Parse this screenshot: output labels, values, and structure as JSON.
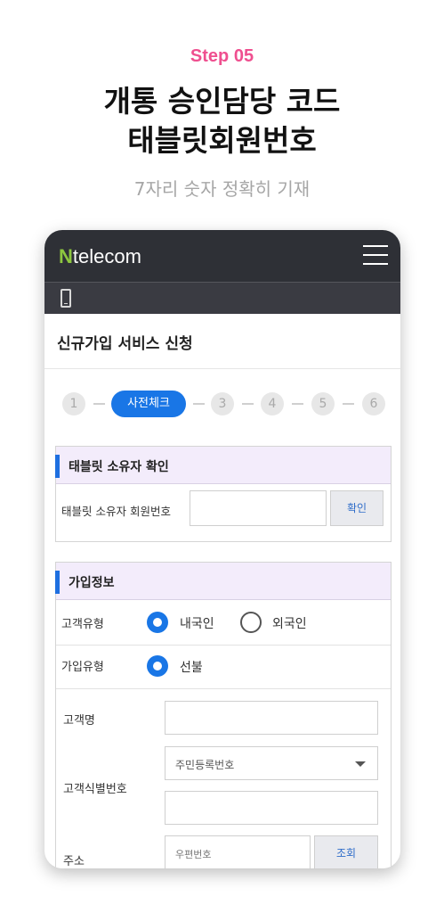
{
  "intro": {
    "step": "Step 05",
    "title_line1": "개통 승인담당 코드",
    "title_line2": "태블릿회원번호",
    "subtitle": "7자리 숫자 정확히 기재"
  },
  "app": {
    "logo_n": "N",
    "logo_rest": "telecom",
    "page_title": "신규가입 서비스 신청"
  },
  "stepper": {
    "steps": [
      "1",
      "사전체크",
      "3",
      "4",
      "5",
      "6"
    ],
    "active": "사전체크"
  },
  "owner_section": {
    "heading": "태블릿 소유자 확인",
    "field_label": "태블릿 소유자 회원번호",
    "field_value": "",
    "confirm_button": "확인"
  },
  "join_section": {
    "heading": "가입정보",
    "customer_type_label": "고객유형",
    "customer_type_options": [
      "내국인",
      "외국인"
    ],
    "customer_type_selected": "내국인",
    "join_type_label": "가입유형",
    "join_type_options": [
      "선불"
    ],
    "join_type_selected": "선불",
    "customer_name_label": "고객명",
    "customer_name_value": "",
    "id_label": "고객식별번호",
    "id_select_value": "주민등록번호",
    "id_value": "",
    "address_label": "주소",
    "zipcode_placeholder": "우편번호",
    "search_button": "조회"
  },
  "colors": {
    "accent_pink": "#ef4f8f",
    "primary_blue": "#1976e6",
    "appbar": "#2e3036",
    "logo_green": "#8dc63f",
    "section_header": "#f3ecfb"
  }
}
